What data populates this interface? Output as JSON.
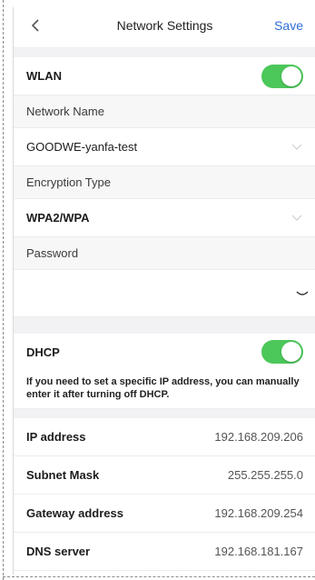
{
  "header": {
    "title": "Network Settings",
    "save_label": "Save"
  },
  "wlan": {
    "label": "WLAN",
    "enabled": true
  },
  "network_name": {
    "label": "Network Name",
    "value": "GOODWE-yanfa-test"
  },
  "encryption": {
    "label": "Encryption Type",
    "value": "WPA2/WPA"
  },
  "password": {
    "label": "Password",
    "value": ""
  },
  "dhcp": {
    "label": "DHCP",
    "enabled": true,
    "note": "If you need to set a specific IP address, you can manually enter it after turning off DHCP."
  },
  "network_fields": [
    {
      "label": "IP address",
      "value": "192.168.209.206"
    },
    {
      "label": "Subnet Mask",
      "value": "255.255.255.0"
    },
    {
      "label": "Gateway address",
      "value": "192.168.209.254"
    },
    {
      "label": "DNS server",
      "value": "192.168.181.167"
    }
  ],
  "colors": {
    "accent": "#2f6fd6",
    "toggle_on": "#4cc75a"
  },
  "icons": {
    "back": "chevron-left-icon",
    "dropdown": "chevron-down-icon",
    "password_visibility": "eye-closed-icon"
  }
}
